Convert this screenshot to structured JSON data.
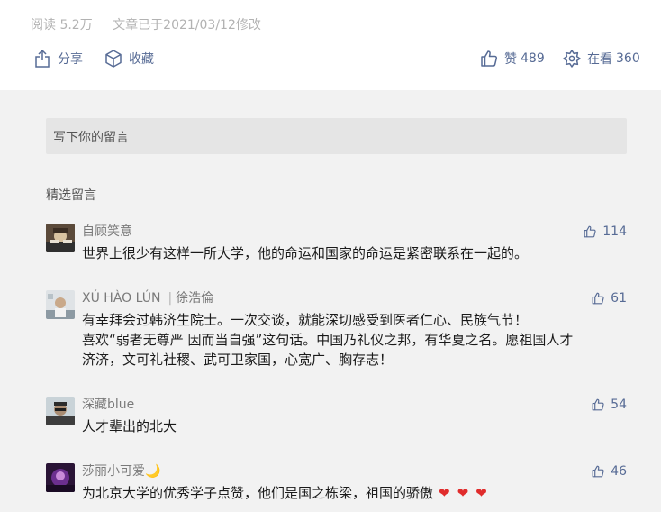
{
  "meta": {
    "read": "阅读 5.2万",
    "edited": "文章已于2021/03/12修改"
  },
  "actions": {
    "share": "分享",
    "favorite": "收藏",
    "like_label": "赞",
    "like_count": "489",
    "watching_label": "在看",
    "watching_count": "360"
  },
  "comment_input": {
    "placeholder": "写下你的留言"
  },
  "section_title": "精选留言",
  "comments": [
    {
      "name": "自顾笑意",
      "name_extra": "",
      "likes": "114",
      "lines": [
        "世界上很少有这样一所大学，他的命运和国家的命运是紧密联系在一起的。"
      ],
      "hearts": ""
    },
    {
      "name": "XÚ HÀO LÚN",
      "name_extra": "徐浩倫",
      "likes": "61",
      "lines": [
        "有幸拜会过韩济生院士。一次交谈，就能深切感受到医者仁心、民族气节！",
        "喜欢“弱者无尊严 因而当自强”这句话。中国乃礼仪之邦，有华夏之名。愿祖国人才",
        "济济，文可礼社稷、武可卫家国，心宽广、胸存志！"
      ],
      "hearts": ""
    },
    {
      "name": "深藏blue",
      "name_extra": "",
      "likes": "54",
      "lines": [
        "人才辈出的北大"
      ],
      "hearts": ""
    },
    {
      "name": "莎丽小可爱🌙",
      "name_extra": "",
      "likes": "46",
      "lines": [
        "为北京大学的优秀学子点赞，他们是国之栋梁，祖国的骄傲"
      ],
      "hearts": "❤❤❤"
    }
  ],
  "colors": {
    "link": "#576b95",
    "heart": "#e02c2c",
    "input_bg": "#e5e5e5",
    "page_bg": "#f2f2f2"
  }
}
